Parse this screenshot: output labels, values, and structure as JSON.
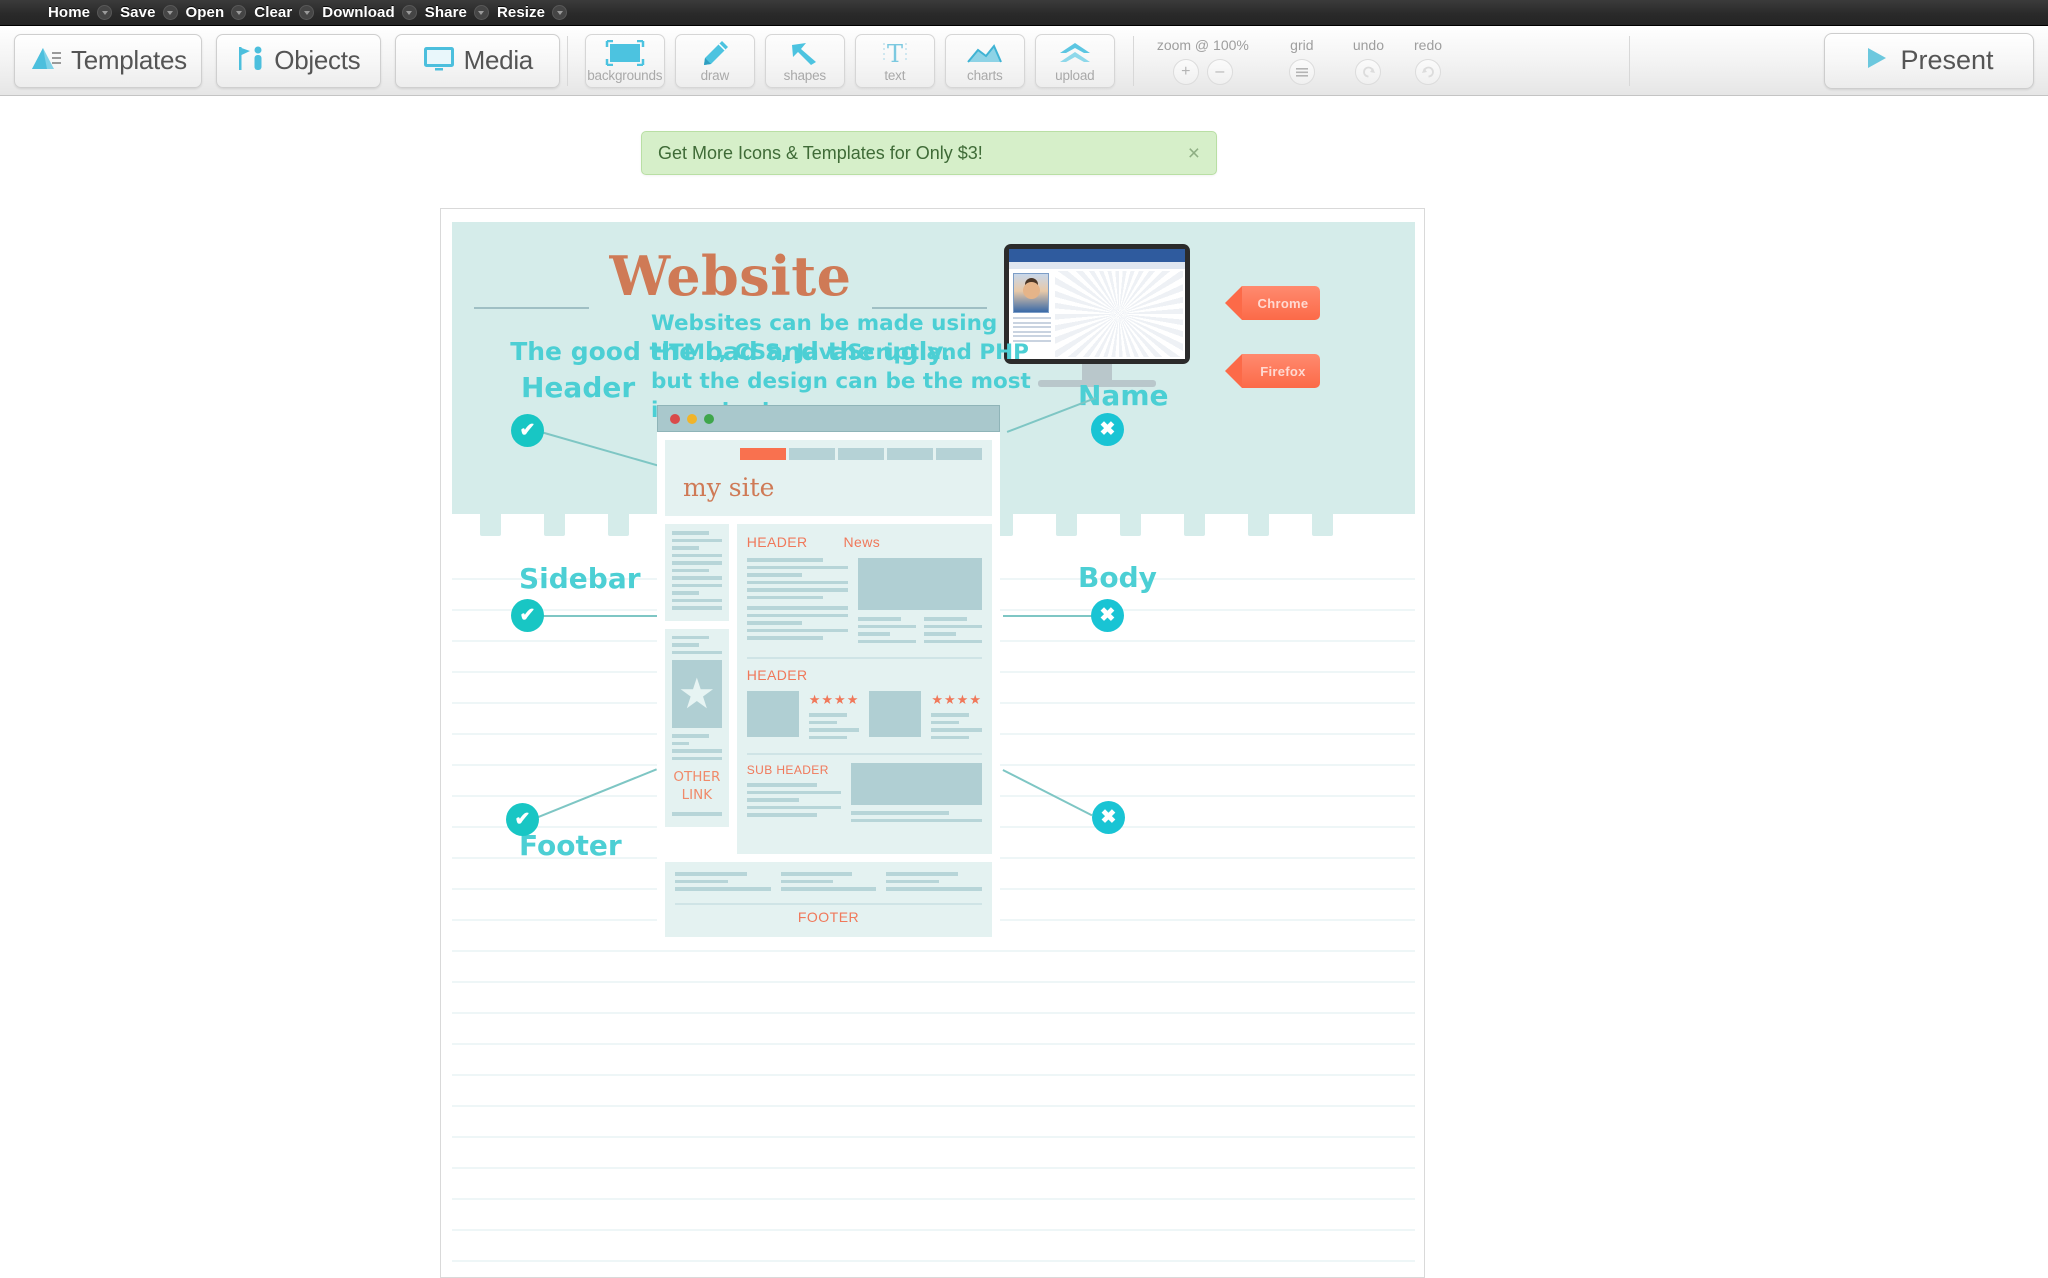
{
  "menubar": {
    "items": [
      {
        "label": "Home",
        "caret": true
      },
      {
        "label": "Save",
        "caret": true
      },
      {
        "label": "Open",
        "caret": true
      },
      {
        "label": "Clear",
        "caret": true
      },
      {
        "label": "Download",
        "caret": true
      },
      {
        "label": "Share",
        "caret": true
      },
      {
        "label": "Resize",
        "caret": true
      }
    ]
  },
  "toolbar": {
    "primary": [
      {
        "label": "Templates",
        "icon": "mountain-icon"
      },
      {
        "label": "Objects",
        "icon": "person-flag-icon"
      },
      {
        "label": "Media",
        "icon": "monitor-icon"
      }
    ],
    "tools": [
      {
        "caption": "backgrounds",
        "icon": "rectangle-icon"
      },
      {
        "caption": "draw",
        "icon": "pencil-icon"
      },
      {
        "caption": "shapes",
        "icon": "arrow-cursor-icon"
      },
      {
        "caption": "text",
        "icon": "text-t-icon"
      },
      {
        "caption": "charts",
        "icon": "line-chart-icon"
      },
      {
        "caption": "upload",
        "icon": "chevron-up-icon"
      }
    ],
    "zoom": {
      "caption": "zoom @ 100%",
      "plus": "+",
      "minus": "–"
    },
    "grid": {
      "caption": "grid",
      "icon": "hamburger-icon"
    },
    "undo": {
      "caption": "undo",
      "icon": "undo-arrow-icon"
    },
    "redo": {
      "caption": "redo",
      "icon": "redo-arrow-icon"
    },
    "present": {
      "label": "Present",
      "icon": "play-triangle-icon"
    }
  },
  "notification": {
    "message": "Get More Icons & Templates for Only $3!",
    "close": "×"
  },
  "canvas": {
    "hero": {
      "title": "Website",
      "subtitle": "The good the bad and the ugly.",
      "tags": [
        {
          "label": "Chrome"
        },
        {
          "label": "Firefox"
        }
      ]
    },
    "intro": "Websites can be made using HTML, CSS, JavaScript and PHP but the design can be the most important.",
    "labels": {
      "header": "Header",
      "sidebar": "Sidebar",
      "footer": "Footer",
      "name": "Name",
      "body": "Body"
    },
    "badges": {
      "check": "✔",
      "cross": "✖"
    },
    "browser_mock": {
      "site_name": "my site",
      "nav_count": 5,
      "sections": {
        "header": "HEADER",
        "news": "News",
        "header2": "HEADER",
        "subheader": "SUB HEADER",
        "other_link": "OTHER LINK",
        "footer": "FOOTER"
      },
      "stars": "★★★★"
    }
  },
  "colors": {
    "accent_teal": "#4ccfd4",
    "accent_orange": "#f0785a",
    "hero_bg": "#d5ecea",
    "title_brown": "#cf7a56",
    "notice_bg": "#d6efc9"
  }
}
